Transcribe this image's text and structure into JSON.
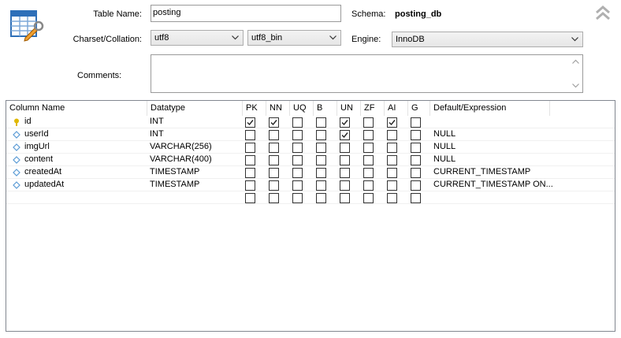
{
  "form": {
    "table_name_label": "Table Name:",
    "table_name_value": "posting",
    "schema_label": "Schema:",
    "schema_value": "posting_db",
    "charset_label": "Charset/Collation:",
    "charset_value": "utf8",
    "collation_value": "utf8_bin",
    "engine_label": "Engine:",
    "engine_value": "InnoDB",
    "comments_label": "Comments:",
    "comments_value": ""
  },
  "grid": {
    "headers": [
      "Column Name",
      "Datatype",
      "PK",
      "NN",
      "UQ",
      "B",
      "UN",
      "ZF",
      "AI",
      "G",
      "Default/Expression"
    ],
    "rows": [
      {
        "name": "id",
        "icon": "primary-key-icon",
        "type": "INT",
        "flags": [
          true,
          true,
          false,
          false,
          true,
          false,
          true,
          false
        ],
        "default": ""
      },
      {
        "name": "userId",
        "icon": "column-icon",
        "type": "INT",
        "flags": [
          false,
          false,
          false,
          false,
          true,
          false,
          false,
          false
        ],
        "default": "NULL"
      },
      {
        "name": "imgUrl",
        "icon": "column-icon",
        "type": "VARCHAR(256)",
        "flags": [
          false,
          false,
          false,
          false,
          false,
          false,
          false,
          false
        ],
        "default": "NULL"
      },
      {
        "name": "content",
        "icon": "column-icon",
        "type": "VARCHAR(400)",
        "flags": [
          false,
          false,
          false,
          false,
          false,
          false,
          false,
          false
        ],
        "default": "NULL"
      },
      {
        "name": "createdAt",
        "icon": "column-icon",
        "type": "TIMESTAMP",
        "flags": [
          false,
          false,
          false,
          false,
          false,
          false,
          false,
          false
        ],
        "default": "CURRENT_TIMESTAMP"
      },
      {
        "name": "updatedAt",
        "icon": "column-icon",
        "type": "TIMESTAMP",
        "flags": [
          false,
          false,
          false,
          false,
          false,
          false,
          false,
          false
        ],
        "default": "CURRENT_TIMESTAMP ON..."
      },
      {
        "name": "",
        "icon": "",
        "type": "",
        "flags": [
          false,
          false,
          false,
          false,
          false,
          false,
          false,
          false
        ],
        "default": ""
      }
    ]
  },
  "colors": {
    "key_icon": "#e0b800",
    "column_icon": "#5b9bd5",
    "border": "#828790"
  }
}
